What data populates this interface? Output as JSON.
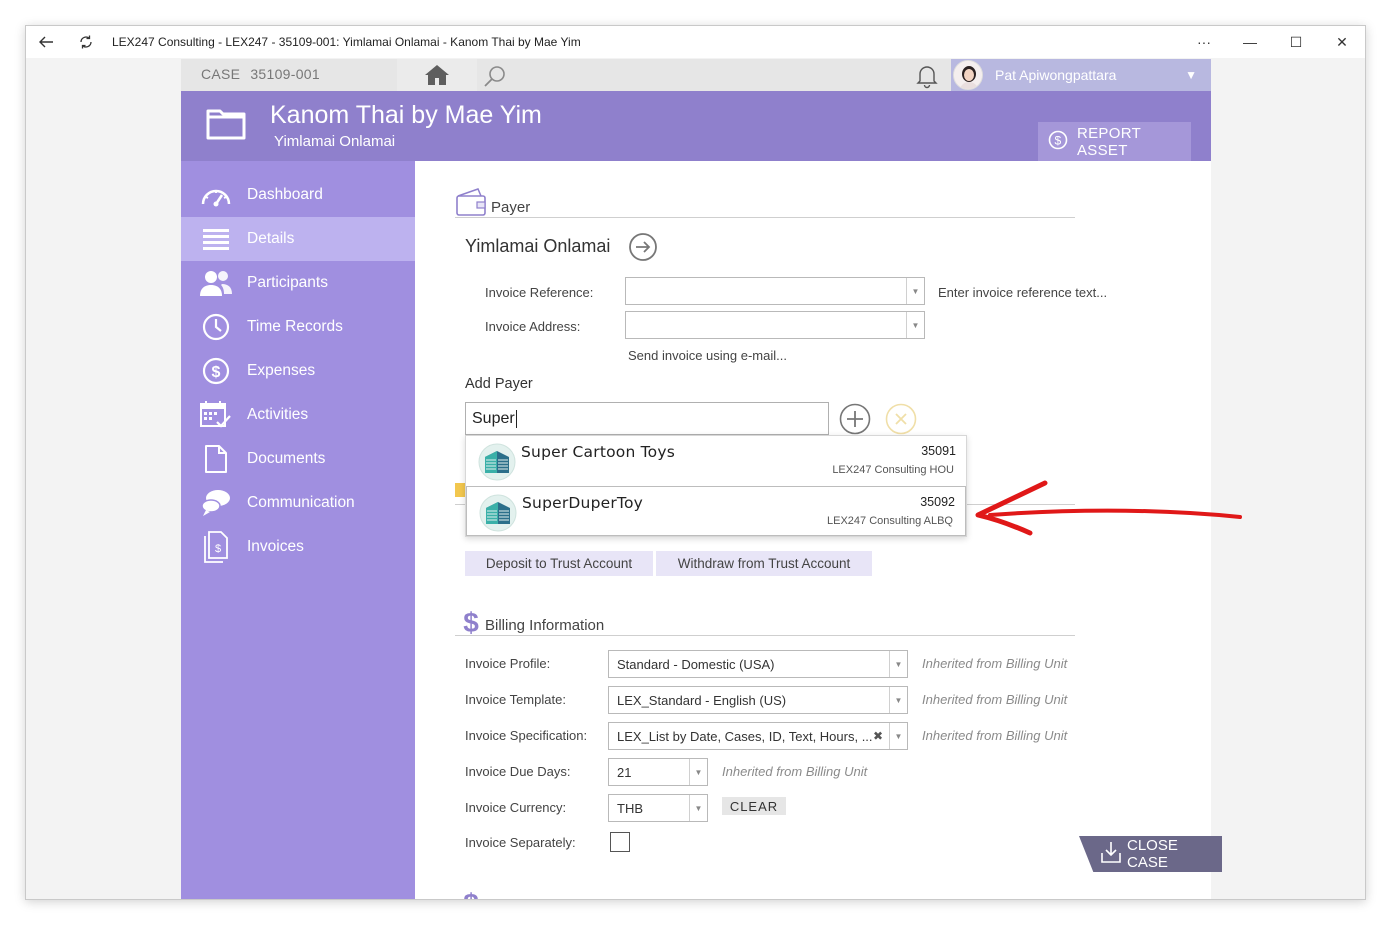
{
  "window": {
    "title": "LEX247 Consulting - LEX247 - 35109-001: Yimlamai Onlamai - Kanom Thai by Mae Yim",
    "more": "···",
    "minimize": "—",
    "maximize": "☐",
    "close": "✕"
  },
  "topbar": {
    "case_label": "CASE",
    "case_number": "35109-001",
    "user_name": "Pat Apiwongpattara"
  },
  "header": {
    "title": "Kanom Thai by Mae Yim",
    "subtitle": "Yimlamai Onlamai",
    "report_asset": "REPORT ASSET"
  },
  "sidebar": {
    "items": [
      {
        "label": "Dashboard",
        "icon": "gauge-icon"
      },
      {
        "label": "Details",
        "icon": "list-icon",
        "active": true
      },
      {
        "label": "Participants",
        "icon": "people-icon"
      },
      {
        "label": "Time Records",
        "icon": "clock-icon"
      },
      {
        "label": "Expenses",
        "icon": "dollar-circle-icon"
      },
      {
        "label": "Activities",
        "icon": "calendar-check-icon"
      },
      {
        "label": "Documents",
        "icon": "document-icon"
      },
      {
        "label": "Communication",
        "icon": "chat-bubbles-icon"
      },
      {
        "label": "Invoices",
        "icon": "invoice-icon"
      }
    ]
  },
  "payer": {
    "section_title": "Payer",
    "name": "Yimlamai Onlamai",
    "invoice_reference_label": "Invoice Reference:",
    "invoice_reference_value": "",
    "invoice_reference_hint": "Enter invoice reference text...",
    "invoice_address_label": "Invoice Address:",
    "invoice_address_value": "",
    "send_email": "Send invoice using e-mail...",
    "add_payer_label": "Add Payer",
    "search_value": "Super",
    "results": [
      {
        "name": "Super Cartoon Toys",
        "number": "35091",
        "office": "LEX247 Consulting HOU"
      },
      {
        "name": "SuperDuperToy",
        "number": "35092",
        "office": "LEX247 Consulting ALBQ"
      }
    ]
  },
  "trust": {
    "deposit": "Deposit to Trust Account",
    "withdraw": "Withdraw from Trust Account"
  },
  "billing": {
    "section_title": "Billing Information",
    "profile_label": "Invoice Profile:",
    "profile_value": "Standard - Domestic (USA)",
    "template_label": "Invoice Template:",
    "template_value": "LEX_Standard - English (US)",
    "spec_label": "Invoice Specification:",
    "spec_value": "LEX_List by Date, Cases, ID, Text, Hours, ...",
    "due_label": "Invoice Due Days:",
    "due_value": "21",
    "currency_label": "Invoice Currency:",
    "currency_value": "THB",
    "clear": "CLEAR",
    "separately_label": "Invoice Separately:",
    "inherited": "Inherited from Billing Unit"
  },
  "close_case": "CLOSE CASE",
  "colors": {
    "header": "#8f80cc",
    "sidebar": "#a08fe0",
    "sidebar_active": "#bdb2ef",
    "annotation_arrow": "#e01818"
  }
}
